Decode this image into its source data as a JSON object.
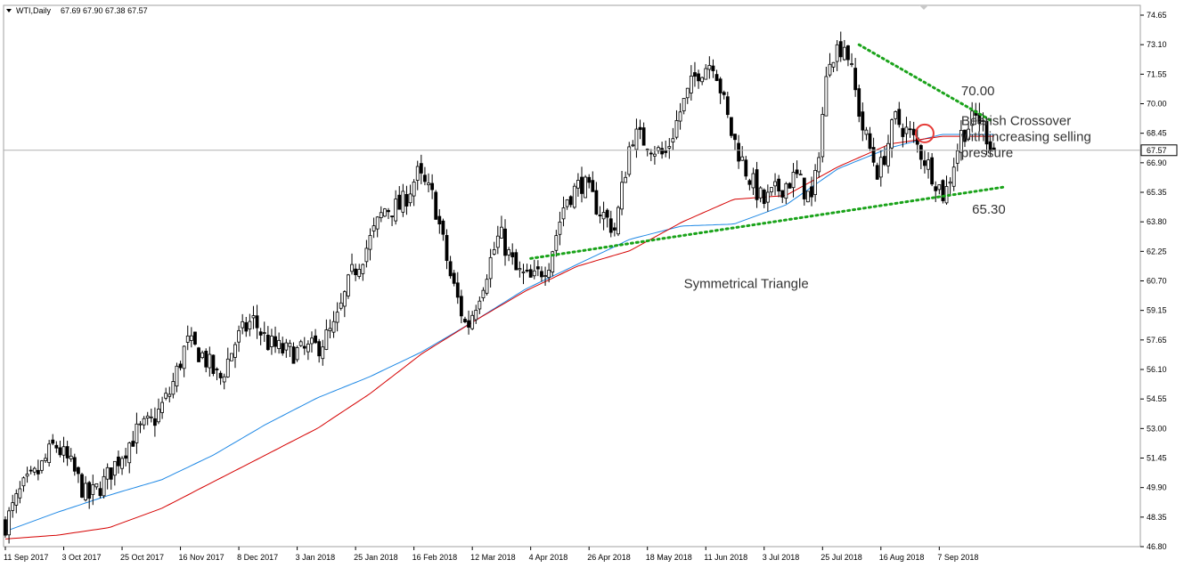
{
  "header": {
    "symbol": "WTI,Daily",
    "ohlc": "67.69 67.90 67.38 67.57"
  },
  "colors": {
    "background": "#ffffff",
    "frame": "#a0a0a0",
    "candle": "#000000",
    "ma_fast": "#1e88e5",
    "ma_slow": "#d50000",
    "trendline": "#1aa31a",
    "marker": "#e53935",
    "current_price_line": "#b0b0b0"
  },
  "chart_data": {
    "type": "candlestick",
    "title": "",
    "xlabel": "",
    "ylabel": "",
    "ylim": [
      46.8,
      74.65
    ],
    "grid": false,
    "current_price": "67.57",
    "y_ticks": [
      "74.65",
      "73.10",
      "71.55",
      "70.00",
      "68.45",
      "66.90",
      "65.35",
      "63.80",
      "62.25",
      "60.70",
      "59.15",
      "57.65",
      "56.10",
      "54.55",
      "53.00",
      "51.45",
      "49.90",
      "48.35",
      "46.80"
    ],
    "x_ticks": [
      "11 Sep 2017",
      "3 Oct 2017",
      "25 Oct 2017",
      "16 Nov 2017",
      "8 Dec 2017",
      "3 Jan 2018",
      "25 Jan 2018",
      "16 Feb 2018",
      "12 Mar 2018",
      "4 Apr 2018",
      "26 Apr 2018",
      "18 May 2018",
      "11 Jun 2018",
      "3 Jul 2018",
      "25 Jul 2018",
      "16 Aug 2018",
      "7 Sep 2018"
    ],
    "x_tick_index": [
      0,
      16,
      32,
      48,
      64,
      80,
      96,
      112,
      128,
      144,
      160,
      176,
      192,
      208,
      224,
      240,
      256
    ],
    "close_path": [
      48.0,
      49.8,
      50.7,
      52.2,
      51.0,
      49.3,
      50.2,
      51.6,
      52.8,
      53.4,
      54.9,
      57.5,
      56.8,
      55.5,
      57.6,
      58.7,
      57.4,
      57.0,
      57.0,
      57.3,
      58.3,
      61.0,
      62.6,
      64.5,
      64.6,
      66.3,
      65.0,
      61.0,
      58.2,
      60.7,
      63.2,
      61.2,
      60.7,
      61.8,
      65.0,
      65.9,
      64.5,
      63.4,
      68.4,
      68.0,
      67.2,
      69.7,
      71.7,
      72.3,
      68.6,
      66.4,
      64.8,
      65.6,
      66.2,
      64.8,
      72.6,
      73.2,
      68.8,
      66.3,
      69.2,
      68.3,
      66.8,
      65.1,
      68.4,
      69.4,
      67.57
    ],
    "ma_fast_path": [
      47.6,
      48.6,
      49.5,
      50.3,
      51.6,
      53.2,
      54.6,
      55.7,
      57.0,
      58.6,
      60.3,
      61.6,
      62.9,
      63.6,
      63.7,
      64.7,
      66.6,
      67.7,
      68.4,
      68.4
    ],
    "ma_slow_path": [
      47.2,
      47.4,
      47.8,
      48.8,
      50.2,
      51.6,
      53.0,
      54.8,
      56.9,
      58.6,
      60.2,
      61.5,
      62.3,
      63.8,
      65.0,
      65.2,
      66.7,
      67.9,
      68.3,
      68.3
    ],
    "series": [
      {
        "name": "",
        "type": "candles"
      },
      {
        "name": "",
        "type": "moving-average-fast"
      },
      {
        "name": "",
        "type": "moving-average-slow"
      }
    ],
    "trendlines": [
      {
        "from": [
          234,
          73.1
        ],
        "to": [
          270,
          69.15
        ]
      },
      {
        "from": [
          144,
          61.9
        ],
        "to": [
          274,
          65.65
        ]
      }
    ],
    "annotations": {
      "resistance": {
        "text": "70.00",
        "bar": 262,
        "price": 70.45
      },
      "bearish": {
        "lines": [
          "Bearish Crossover",
          "with increasing selling",
          "pressure"
        ],
        "bar": 262,
        "price": 68.9
      },
      "support": {
        "text": "65.30",
        "bar": 265,
        "price": 64.25
      },
      "pattern": {
        "text": "Symmetrical Triangle",
        "bar": 186,
        "price": 60.35
      }
    },
    "marker": {
      "bar": 252,
      "price": 68.45
    }
  }
}
